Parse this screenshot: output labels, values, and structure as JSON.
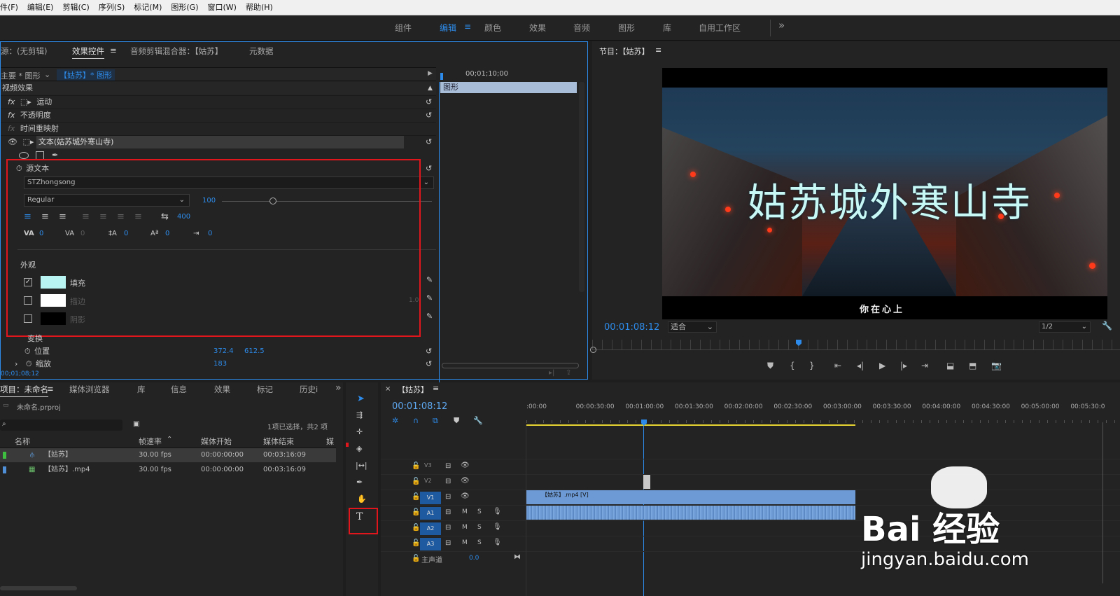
{
  "menu": [
    "件(F)",
    "编辑(E)",
    "剪辑(C)",
    "序列(S)",
    "标记(M)",
    "图形(G)",
    "窗口(W)",
    "帮助(H)"
  ],
  "workspaces": {
    "items": [
      "组件",
      "编辑",
      "颜色",
      "效果",
      "音频",
      "图形",
      "库",
      "自用工作区"
    ],
    "active": "编辑",
    "menu_icon": "≡",
    "overflow": "»"
  },
  "source_panel": {
    "tabs": [
      "源：(无剪辑)",
      "效果控件",
      "音频剪辑混合器：【姑苏】",
      "元数据"
    ],
    "active_tab_menu": "≡",
    "clip_path_left": "主要 * 图形",
    "clip_path_right": "【姑苏】* 图形",
    "timecode_ruler": "00;01;10;00",
    "clip_label": "图形",
    "section_video": "视频效果",
    "effects": [
      "运动",
      "不透明度",
      "时间重映射",
      "文本(姑苏城外寒山寺)"
    ],
    "source_text_label": "源文本",
    "font_name": "STZhongsong",
    "font_style": "Regular",
    "font_size": "100",
    "tracking_value": "400",
    "metrics": [
      "0",
      "0",
      "0",
      "0",
      "0"
    ],
    "appearance_label": "外观",
    "fill_label": "填充",
    "stroke_label": "描边",
    "stroke_value": "1.0",
    "shadow_label": "阴影",
    "fill_color": "#b8f4f2",
    "transform_label": "变换",
    "position_label": "位置",
    "position_x": "372.4",
    "position_y": "612.5",
    "scale_label": "缩放",
    "scale_value": "183",
    "bottom_timecode": "00;01;08;12"
  },
  "program": {
    "title": "节目：【姑苏】",
    "title_menu": "≡",
    "overlay_text": "姑苏城外寒山寺",
    "subtitle_text": "你在心上",
    "timecode": "00:01:08:12",
    "fit": "适合",
    "resolution": "1/2"
  },
  "project": {
    "tabs": [
      "项目：未命名",
      "媒体浏览器",
      "库",
      "信息",
      "效果",
      "标记",
      "历史i"
    ],
    "tab_menu": "≡",
    "overflow": "»",
    "file": "未命名.prproj",
    "selection_info": "1项已选择，共2 项",
    "columns": [
      "名称",
      "帧速率",
      "媒体开始",
      "媒体结束",
      "媒体"
    ],
    "rows": [
      {
        "name": "【姑苏】",
        "fps": "30.00 fps",
        "start": "00:00:00:00",
        "end": "00:03:16:09",
        "color": "#3fbf3f"
      },
      {
        "name": "【姑苏】.mp4",
        "fps": "30.00 fps",
        "start": "00:00:00:00",
        "end": "00:03:16:09",
        "color": "#4f8fd8"
      }
    ]
  },
  "timeline": {
    "tab": "【姑苏】",
    "tab_menu": "≡",
    "close": "×",
    "timecode": "00:01:08:12",
    "ruler": [
      ":00:00",
      "00:00:30:00",
      "00:01:00:00",
      "00:01:30:00",
      "00:02:00:00",
      "00:02:30:00",
      "00:03:00:00",
      "00:03:30:00",
      "00:04:00:00",
      "00:04:30:00",
      "00:05:00:00",
      "00:05:30:0"
    ],
    "tracks": [
      "V3",
      "V2",
      "V1",
      "A1",
      "A2",
      "A3"
    ],
    "master_label": "主声道",
    "master_value": "0.0",
    "clip_label": "【姑苏】.mp4 [V]"
  },
  "watermark": {
    "brand": "Bai 经验",
    "url": "jingyan.baidu.com"
  }
}
